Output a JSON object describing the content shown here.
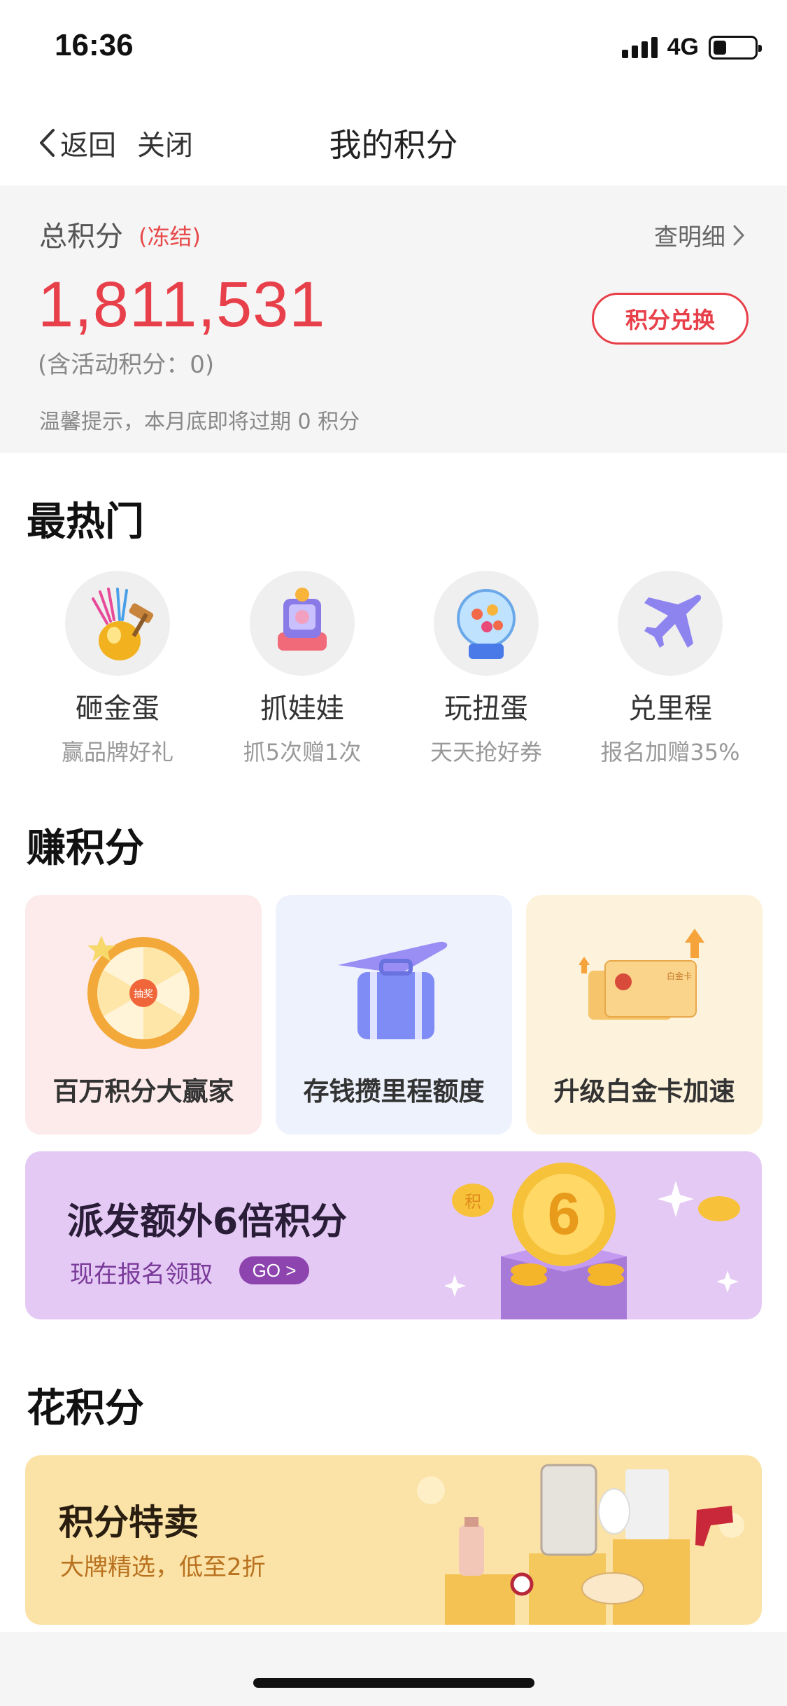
{
  "status_bar": {
    "time": "16:36",
    "network": "4G"
  },
  "nav": {
    "back_label": "返回",
    "close_label": "关闭",
    "title": "我的积分"
  },
  "points": {
    "label": "总积分",
    "frozen_label": "(冻结)",
    "detail_label": "查明细",
    "total": "1,811,531",
    "activity": "(含活动积分：0)",
    "exchange_button": "积分兑换",
    "tip": "温馨提示，本月底即将过期 0 积分"
  },
  "hot": {
    "title": "最热门",
    "items": [
      {
        "name": "砸金蛋",
        "sub": "赢品牌好礼",
        "icon": "golden-egg-icon"
      },
      {
        "name": "抓娃娃",
        "sub": "抓5次赠1次",
        "icon": "claw-machine-icon"
      },
      {
        "name": "玩扭蛋",
        "sub": "天天抢好券",
        "icon": "gacha-machine-icon"
      },
      {
        "name": "兑里程",
        "sub": "报名加赠35%",
        "icon": "airplane-icon"
      }
    ]
  },
  "earn": {
    "title": "赚积分",
    "cards": [
      {
        "label": "百万积分大赢家",
        "wheel_center": "抽奖"
      },
      {
        "label": "存钱攒里程额度"
      },
      {
        "label": "升级白金卡加速",
        "card_text": "白金卡"
      }
    ]
  },
  "promo": {
    "title": "派发额外6倍积分",
    "subtitle": "现在报名领取",
    "go_label": "GO >",
    "badge": "6",
    "coin_text": "积"
  },
  "spend": {
    "title": "花积分",
    "banner_title": "积分特卖",
    "banner_subtitle": "大牌精选，低至2折"
  },
  "colors": {
    "accent": "#e8404a",
    "promo_bg": "#e4c9f4",
    "sale_bg": "#fbe2a6"
  }
}
